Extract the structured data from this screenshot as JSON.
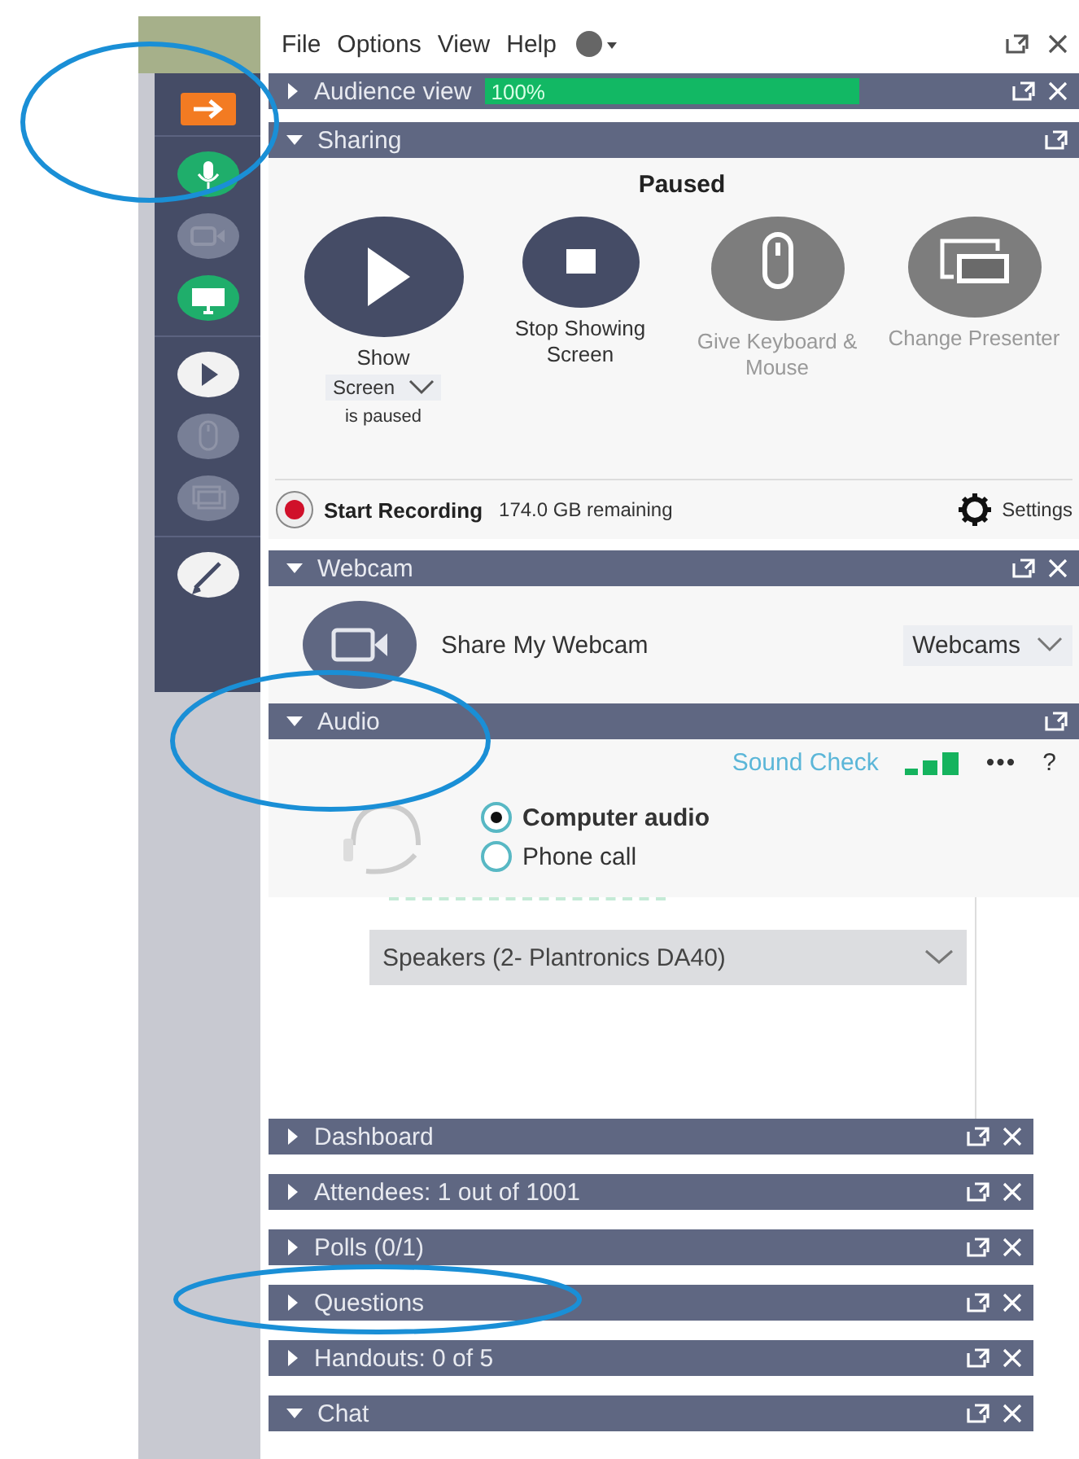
{
  "menu": [
    "File",
    "Options",
    "View",
    "Help"
  ],
  "sidebar": [
    {
      "kind": "arrow",
      "on": true,
      "disabled": false
    },
    {
      "kind": "mic",
      "on": true,
      "disabled": false
    },
    {
      "kind": "webcam",
      "on": false,
      "disabled": true
    },
    {
      "kind": "screen",
      "on": true,
      "disabled": false
    },
    {
      "kind": "play",
      "on": false,
      "disabled": false
    },
    {
      "kind": "mouse",
      "on": false,
      "disabled": true
    },
    {
      "kind": "presenter",
      "on": false,
      "disabled": true
    },
    {
      "kind": "pen",
      "on": false,
      "disabled": false
    }
  ],
  "audience_view": {
    "title": "Audience view",
    "expanded": false,
    "close": true,
    "level": 1,
    "reading": "100%"
  },
  "sharing": {
    "title": "Sharing",
    "expanded": true,
    "close": false,
    "status": "Paused",
    "buttons": [
      {
        "kind": "play",
        "label": "Show",
        "disabled": false
      },
      {
        "kind": "stop",
        "label": "Stop Showing Screen",
        "disabled": false
      },
      {
        "kind": "mouse",
        "label": "Give Keyboard & Mouse",
        "disabled": true
      },
      {
        "kind": "presenter",
        "label": "Change Presenter",
        "disabled": true
      }
    ],
    "show_select": "Screen",
    "show_note": "is paused",
    "recording": {
      "label": "Start Recording",
      "remaining": "174.0 GB remaining",
      "settings": "Settings"
    }
  },
  "webcam": {
    "title": "Webcam",
    "expanded": true,
    "close": true,
    "label": "Share My Webcam",
    "select": "Webcams"
  },
  "audio": {
    "title": "Audio",
    "expanded": true,
    "close": false,
    "sound_check": "Sound Check",
    "more": "•••",
    "help": "?",
    "options": [
      {
        "label": "Computer audio",
        "selected": true
      },
      {
        "label": "Phone call",
        "selected": false
      }
    ],
    "speaker": "Speakers (2- Plantronics DA40)"
  },
  "panes": [
    {
      "title": "Dashboard",
      "expanded": false,
      "close": true
    },
    {
      "title": "Attendees: 1 out of 1001",
      "expanded": false,
      "close": true
    },
    {
      "title": "Polls (0/1)",
      "expanded": false,
      "close": true
    },
    {
      "title": "Questions",
      "expanded": false,
      "close": true
    },
    {
      "title": "Handouts: 0 of 5",
      "expanded": false,
      "close": true
    },
    {
      "title": "Chat",
      "expanded": true,
      "close": true
    }
  ]
}
